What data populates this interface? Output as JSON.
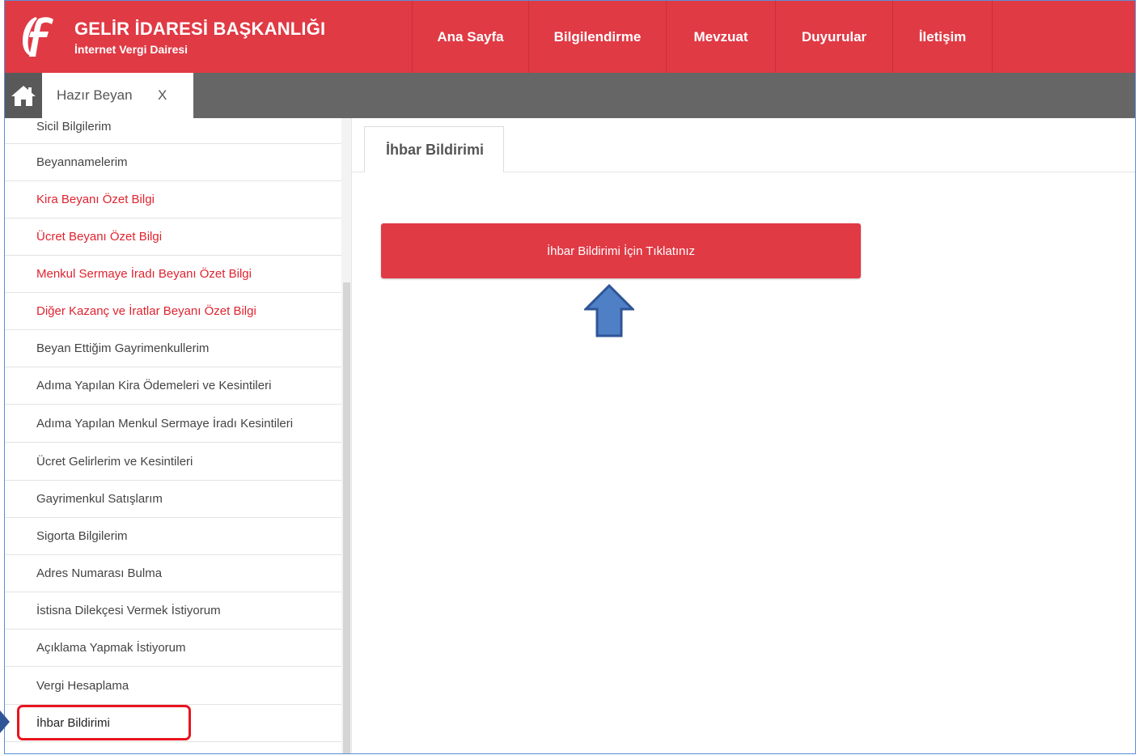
{
  "header": {
    "title": "GELİR İDARESİ BAŞKANLIĞI",
    "subtitle": "İnternet Vergi Dairesi",
    "nav": [
      {
        "label": "Ana Sayfa"
      },
      {
        "label": "Bilgilendirme"
      },
      {
        "label": "Mevzuat"
      },
      {
        "label": "Duyurular"
      },
      {
        "label": "İletişim"
      }
    ]
  },
  "tabbar": {
    "home_icon": "home-icon",
    "active_tab": "Hazır Beyan",
    "close_label": "X"
  },
  "sidebar": {
    "items": [
      {
        "label": "Sicil Bilgilerim"
      },
      {
        "label": "Beyannamelerim"
      },
      {
        "label": "Kira Beyanı Özet Bilgi"
      },
      {
        "label": "Ücret Beyanı Özet Bilgi"
      },
      {
        "label": "Menkul Sermaye İradı Beyanı Özet Bilgi"
      },
      {
        "label": "Diğer Kazanç ve İratlar Beyanı Özet Bilgi"
      },
      {
        "label": "Beyan Ettiğim Gayrimenkullerim"
      },
      {
        "label": "Adıma Yapılan Kira Ödemeleri ve Kesintileri"
      },
      {
        "label": "Adıma Yapılan Menkul Sermaye İradı Kesintileri"
      },
      {
        "label": "Ücret Gelirlerim ve Kesintileri"
      },
      {
        "label": "Gayrimenkul Satışlarım"
      },
      {
        "label": "Sigorta Bilgilerim"
      },
      {
        "label": "Adres Numarası Bulma"
      },
      {
        "label": "İstisna Dilekçesi Vermek İstiyorum"
      },
      {
        "label": "Açıklama Yapmak İstiyorum"
      },
      {
        "label": "Vergi Hesaplama"
      },
      {
        "label": "İhbar Bildirimi"
      }
    ]
  },
  "main": {
    "tab_label": "İhbar Bildirimi",
    "cta_label": "İhbar Bildirimi İçin Tıklatınız"
  },
  "colors": {
    "brand_red": "#e03a45",
    "tabbar_gray": "#666666",
    "alert_red": "#e0232f",
    "arrow_blue": "#4f7fc4"
  }
}
